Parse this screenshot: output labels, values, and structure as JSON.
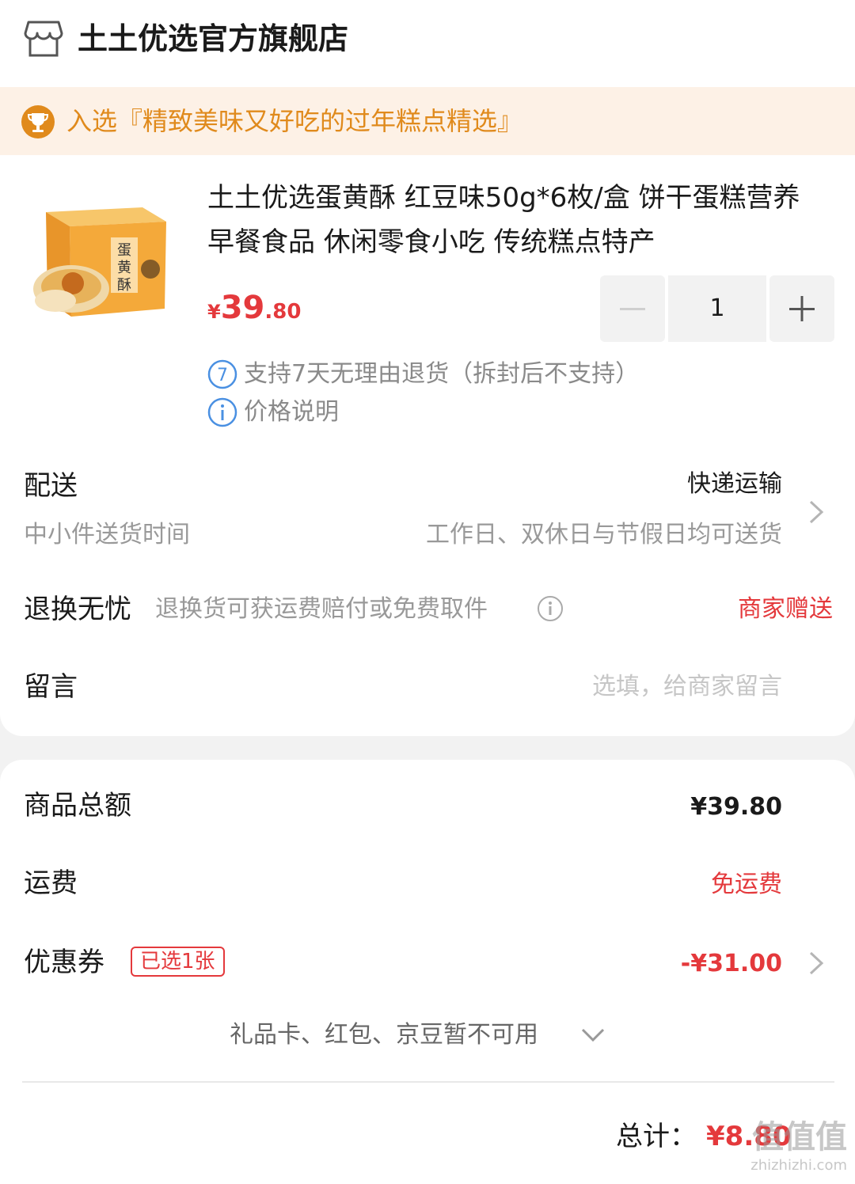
{
  "store": {
    "name": "土土优选官方旗舰店",
    "icon": "store-icon"
  },
  "award": {
    "text": "入选『精致美味又好吃的过年糕点精选』",
    "icon": "trophy-icon",
    "color": "#e08a1c",
    "background": "#fdf1e6"
  },
  "product": {
    "title": "土土优选蛋黄酥 红豆味50g*6枚/盒 饼干蛋糕营养早餐食品 休闲零食小吃 传统糕点特产",
    "image_name": "product-thumbnail",
    "price_currency": "¥",
    "price_integer": "39",
    "price_decimal": ".80",
    "quantity": "1",
    "return_policy": "支持7天无理由退货（拆封后不支持）",
    "return_policy_badge": "7",
    "price_note": "价格说明"
  },
  "delivery": {
    "label": "配送",
    "method": "快递运输",
    "sub_label": "中小件送货时间",
    "sub_value": "工作日、双休日与节假日均可送货"
  },
  "worry_free": {
    "label": "退换无忧",
    "description": "退换货可获运费赔付或免费取件",
    "value": "商家赠送"
  },
  "message": {
    "label": "留言",
    "placeholder": "选填，给商家留言"
  },
  "summary": {
    "subtotal_label": "商品总额",
    "subtotal_value": "¥39.80",
    "shipping_label": "运费",
    "shipping_value": "免运费",
    "coupon_label": "优惠券",
    "coupon_tag": "已选1张",
    "coupon_value": "-¥31.00",
    "unavailable_text": "礼品卡、红包、京豆暂不可用",
    "total_label": "总计：",
    "total_value": "¥8.80"
  },
  "watermark": {
    "text": "值值值",
    "subtext": "zhizhizhi.com"
  },
  "colors": {
    "accent_red": "#e4393c",
    "text_primary": "#1a1a1a",
    "text_secondary": "#999999",
    "info_blue": "#4a90e2"
  }
}
